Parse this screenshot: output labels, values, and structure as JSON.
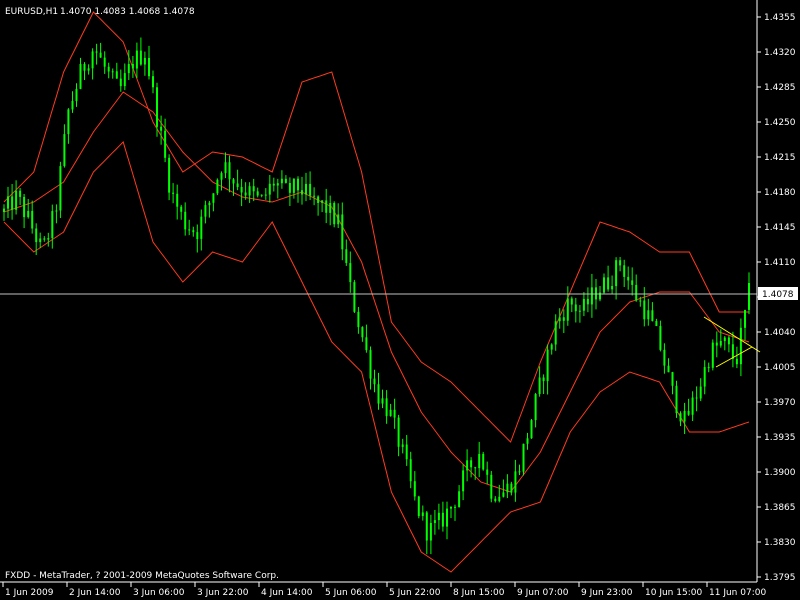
{
  "header": {
    "symbol": "EURUSD,H1",
    "ohlc": "1.4070 1.4083 1.4068 1.4078"
  },
  "footer": {
    "copyright": "FXDD - MetaTrader, ? 2001-2009 MetaQuotes Software Corp."
  },
  "current_price": {
    "label": "1.4078",
    "value": 1.4078
  },
  "colors": {
    "background": "#000000",
    "candles": "#00ff00",
    "bands": "#ff3b1f",
    "axis": "#ffffff",
    "price_line": "#c0c0c0",
    "trendline": "#ffff00"
  },
  "chart_data": {
    "type": "candlestick",
    "yticks": [
      "1.4355",
      "1.4320",
      "1.4285",
      "1.4250",
      "1.4215",
      "1.4180",
      "1.4145",
      "1.4110",
      "1.4075",
      "1.4040",
      "1.4005",
      "1.3970",
      "1.3935",
      "1.3900",
      "1.3865",
      "1.3830",
      "1.3795"
    ],
    "ylim": [
      1.3795,
      1.436
    ],
    "xticks": [
      "1 Jun 2009",
      "2 Jun 14:00",
      "3 Jun 06:00",
      "3 Jun 22:00",
      "4 Jun 14:00",
      "5 Jun 06:00",
      "5 Jun 22:00",
      "8 Jun 15:00",
      "9 Jun 07:00",
      "9 Jun 23:00",
      "10 Jun 15:00",
      "11 Jun 07:00"
    ],
    "bar_count": 186,
    "close_path": [
      1.416,
      1.4175,
      1.415,
      1.412,
      1.416,
      1.426,
      1.43,
      1.4325,
      1.43,
      1.428,
      1.431,
      1.432,
      1.425,
      1.418,
      1.415,
      1.414,
      1.417,
      1.421,
      1.419,
      1.418,
      1.417,
      1.419,
      1.418,
      1.4185,
      1.417,
      1.4165,
      1.415,
      1.408,
      1.403,
      1.398,
      1.396,
      1.392,
      1.387,
      1.384,
      1.385,
      1.387,
      1.39,
      1.392,
      1.388,
      1.388,
      1.39,
      1.395,
      1.4,
      1.405,
      1.407,
      1.406,
      1.408,
      1.409,
      1.411,
      1.408,
      1.406,
      1.403,
      1.398,
      1.395,
      1.398,
      1.402,
      1.403,
      1.401,
      1.4078
    ],
    "upper_band": [
      1.417,
      1.42,
      1.43,
      1.436,
      1.433,
      1.425,
      1.42,
      1.422,
      1.4215,
      1.42,
      1.429,
      1.43,
      1.42,
      1.405,
      1.401,
      1.399,
      1.396,
      1.393,
      1.401,
      1.408,
      1.415,
      1.414,
      1.412,
      1.412,
      1.406,
      1.406
    ],
    "middle_band": [
      1.416,
      1.417,
      1.419,
      1.424,
      1.428,
      1.426,
      1.422,
      1.419,
      1.4175,
      1.417,
      1.418,
      1.4165,
      1.411,
      1.402,
      1.396,
      1.392,
      1.389,
      1.388,
      1.392,
      1.398,
      1.404,
      1.407,
      1.408,
      1.408,
      1.404,
      1.403
    ],
    "lower_band": [
      1.415,
      1.412,
      1.414,
      1.42,
      1.423,
      1.413,
      1.409,
      1.412,
      1.411,
      1.415,
      1.409,
      1.403,
      1.4,
      1.388,
      1.382,
      1.38,
      1.383,
      1.386,
      1.387,
      1.394,
      1.398,
      1.4,
      1.399,
      1.394,
      1.394,
      1.395
    ],
    "trendline": [
      [
        1.4055,
        1.403
      ],
      [
        1.4005,
        1.399
      ]
    ]
  }
}
